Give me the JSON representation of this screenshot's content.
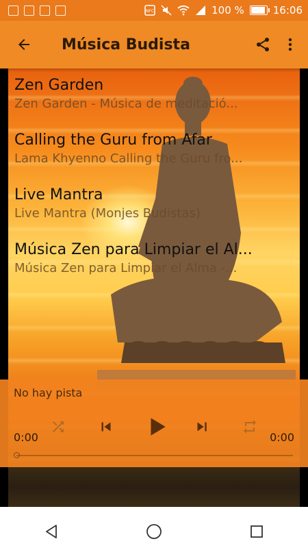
{
  "status_bar": {
    "battery": "100 %",
    "battery_level": 1.0,
    "time": "16:06",
    "icons": [
      "app-notification-icon",
      "image-notification-icon",
      "image-notification-icon",
      "image-notification-icon",
      "nfc-icon",
      "mute-icon",
      "wifi-icon",
      "signal-icon",
      "battery-icon"
    ]
  },
  "app_bar": {
    "title": "Música Budista",
    "back_icon": "arrow-back-icon",
    "share_icon": "share-icon",
    "more_icon": "more-vert-icon"
  },
  "tracks": [
    {
      "title": "Zen Garden",
      "subtitle": "Zen Garden - Música de meditació..."
    },
    {
      "title": "Calling the Guru from Afar",
      "subtitle": "Lama Khyenno Calling the Guru fro..."
    },
    {
      "title": "Live Mantra",
      "subtitle": "Live Mantra (Monjes Budistas)"
    },
    {
      "title": "Música Zen para Limpiar el Al...",
      "subtitle": "Música Zen para Limpiar el Alma -..."
    }
  ],
  "player": {
    "now_playing": "No hay pista",
    "time_elapsed": "0:00",
    "time_total": "0:00",
    "progress": 0.0
  },
  "colors": {
    "status_bar": "#ea7a1c",
    "app_bar": "#f08a24",
    "player_panel": "#f2821e",
    "control_icon": "#5a2e0c"
  }
}
